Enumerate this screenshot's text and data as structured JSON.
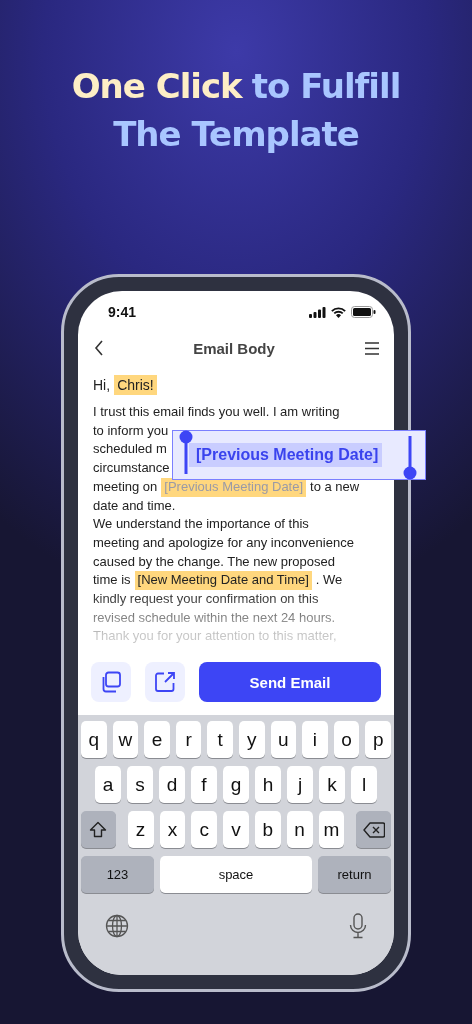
{
  "headline": {
    "lines": [
      [
        {
          "text": "One Click",
          "accent": true
        },
        {
          "text": "to Fulfill",
          "accent": false
        }
      ],
      [
        {
          "text": "The Template",
          "accent": false
        }
      ]
    ]
  },
  "status_bar": {
    "time": "9:41"
  },
  "nav": {
    "title": "Email Body"
  },
  "greeting": [
    {
      "text": "Hi,",
      "highlighted": false
    },
    {
      "text": "Chris!",
      "highlighted": true,
      "selected": false
    }
  ],
  "body": {
    "lines": [
      [
        {
          "text": "I trust this email finds you well. I am writing",
          "highlighted": false
        }
      ],
      [
        {
          "text": "to inform you",
          "highlighted": false
        }
      ],
      [
        {
          "text": "scheduled m",
          "highlighted": false
        }
      ],
      [
        {
          "text": "circumstance",
          "highlighted": false
        }
      ],
      [
        {
          "text": "meeting on",
          "highlighted": false
        },
        {
          "text": "[Previous Meeting Date]",
          "highlighted": true,
          "selected": true
        },
        {
          "text": "to a new",
          "highlighted": false
        }
      ],
      [
        {
          "text": "date and time.",
          "highlighted": false
        }
      ],
      [
        {
          "text": "We understand the importance of this",
          "highlighted": false
        }
      ],
      [
        {
          "text": "meeting and apologize for any inconvenience",
          "highlighted": false
        }
      ],
      [
        {
          "text": "caused by the change. The new proposed",
          "highlighted": false
        }
      ],
      [
        {
          "text": "time is",
          "highlighted": false
        },
        {
          "text": "[New Meeting Date and Time]",
          "highlighted": true,
          "selected": false
        },
        {
          "text": ". We",
          "highlighted": false
        }
      ],
      [
        {
          "text": "kindly request your confirmation on this",
          "highlighted": false
        }
      ],
      [
        {
          "text": "revised schedule within the next 24 hours.",
          "highlighted": false
        }
      ],
      [
        {
          "text": "Thank you for your attention to this matter,",
          "highlighted": false
        }
      ]
    ]
  },
  "magnifier": {
    "text": "[Previous Meeting Date]"
  },
  "actions": {
    "send_label": "Send Email"
  },
  "keyboard": {
    "rows": [
      {
        "keys": [
          {
            "kind": "letter",
            "label": "q"
          },
          {
            "kind": "letter",
            "label": "w"
          },
          {
            "kind": "letter",
            "label": "e"
          },
          {
            "kind": "letter",
            "label": "r"
          },
          {
            "kind": "letter",
            "label": "t"
          },
          {
            "kind": "letter",
            "label": "y"
          },
          {
            "kind": "letter",
            "label": "u"
          },
          {
            "kind": "letter",
            "label": "i"
          },
          {
            "kind": "letter",
            "label": "o"
          },
          {
            "kind": "letter",
            "label": "p"
          }
        ]
      },
      {
        "keys": [
          {
            "kind": "letter",
            "label": "a"
          },
          {
            "kind": "letter",
            "label": "s"
          },
          {
            "kind": "letter",
            "label": "d"
          },
          {
            "kind": "letter",
            "label": "f"
          },
          {
            "kind": "letter",
            "label": "g"
          },
          {
            "kind": "letter",
            "label": "h"
          },
          {
            "kind": "letter",
            "label": "j"
          },
          {
            "kind": "letter",
            "label": "k"
          },
          {
            "kind": "letter",
            "label": "l"
          }
        ]
      },
      {
        "keys": [
          {
            "kind": "shift"
          },
          {
            "kind": "letter",
            "label": "z"
          },
          {
            "kind": "letter",
            "label": "x"
          },
          {
            "kind": "letter",
            "label": "c"
          },
          {
            "kind": "letter",
            "label": "v"
          },
          {
            "kind": "letter",
            "label": "b"
          },
          {
            "kind": "letter",
            "label": "n"
          },
          {
            "kind": "letter",
            "label": "m"
          },
          {
            "kind": "delete"
          }
        ]
      },
      {
        "keys": [
          {
            "kind": "numbers",
            "label": "123"
          },
          {
            "kind": "space",
            "label": "space"
          },
          {
            "kind": "return",
            "label": "return"
          }
        ]
      }
    ]
  }
}
